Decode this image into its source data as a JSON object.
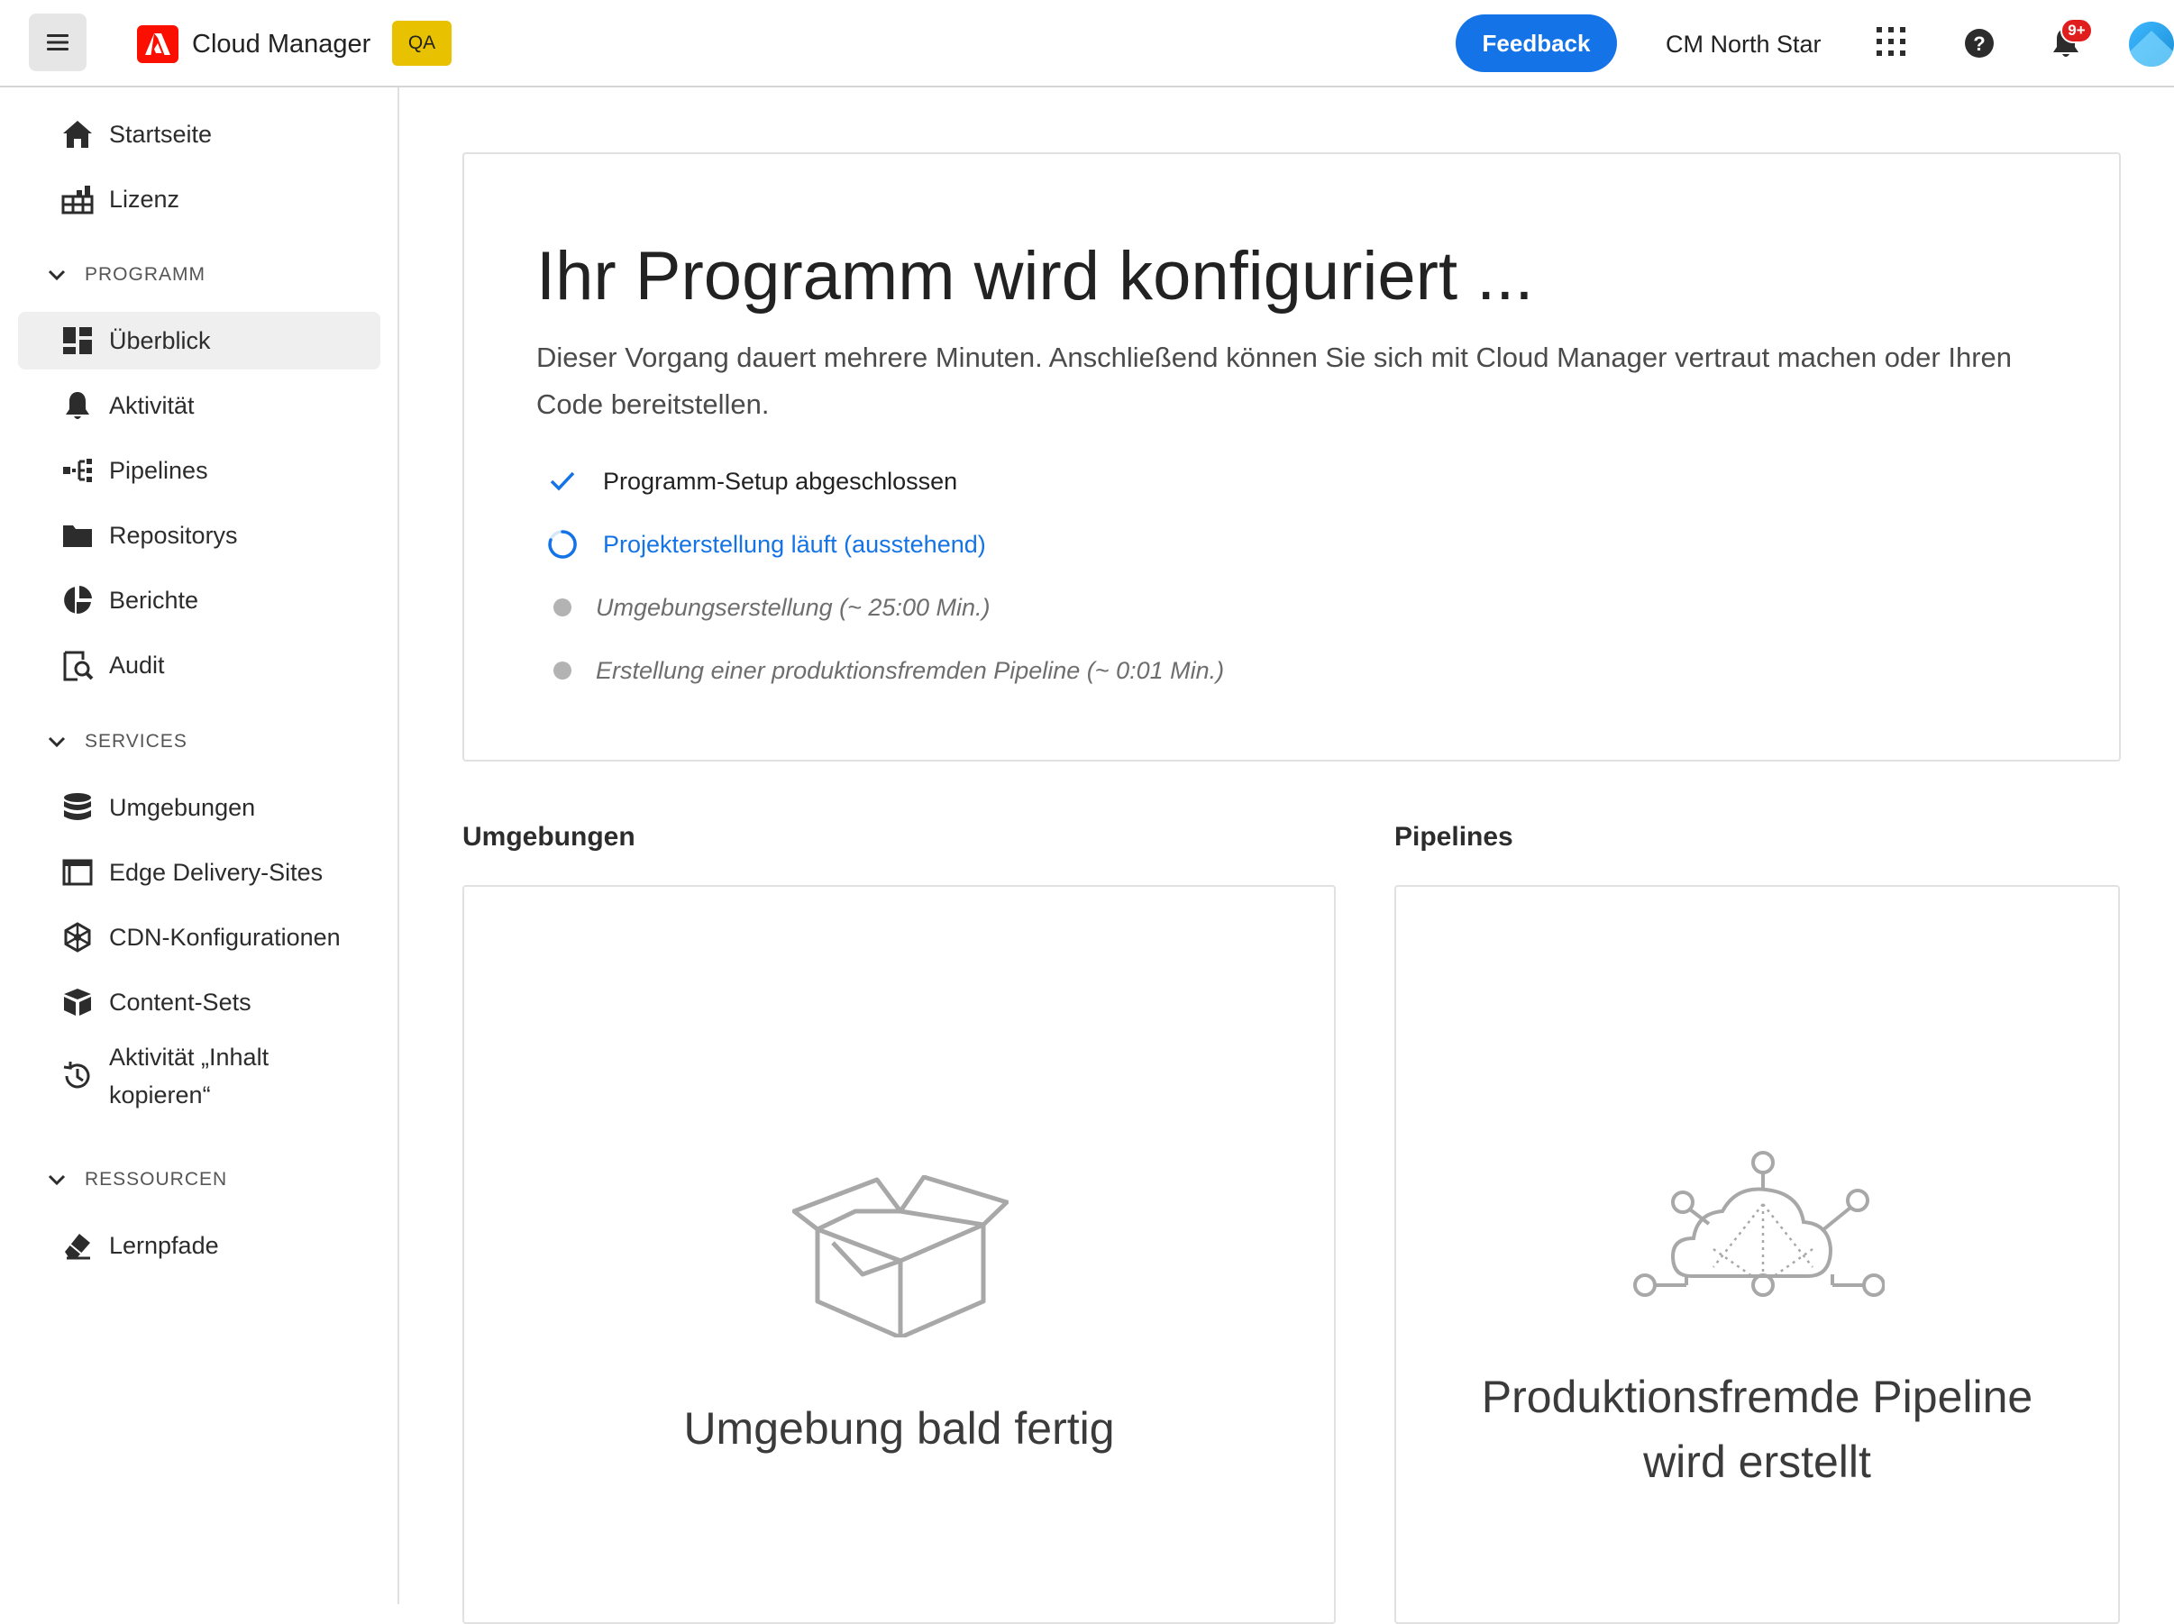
{
  "header": {
    "menu_icon": "hamburger-icon",
    "logo_icon": "adobe-logo-icon",
    "app_title": "Cloud Manager",
    "env_badge": "QA",
    "feedback_label": "Feedback",
    "org_name": "CM North Star",
    "apps_icon": "app-switcher-icon",
    "help_icon": "help-icon",
    "notifications_icon": "bell-icon",
    "notification_count": "9+",
    "accent_color": "#1473e6",
    "brand_color": "#fa0f00"
  },
  "sidebar": {
    "top_items": [
      {
        "label": "Startseite",
        "icon": "home-icon"
      },
      {
        "label": "Lizenz",
        "icon": "license-icon"
      }
    ],
    "sections": [
      {
        "title": "PROGRAMM",
        "items": [
          {
            "label": "Überblick",
            "icon": "dashboard-icon",
            "active": true
          },
          {
            "label": "Aktivität",
            "icon": "bell-icon"
          },
          {
            "label": "Pipelines",
            "icon": "pipeline-icon"
          },
          {
            "label": "Repositorys",
            "icon": "folder-icon"
          },
          {
            "label": "Berichte",
            "icon": "pie-chart-icon"
          },
          {
            "label": "Audit",
            "icon": "audit-icon"
          }
        ]
      },
      {
        "title": "SERVICES",
        "items": [
          {
            "label": "Umgebungen",
            "icon": "database-icon"
          },
          {
            "label": "Edge Delivery-Sites",
            "icon": "browser-window-icon"
          },
          {
            "label": "CDN-Konfigurationen",
            "icon": "cdn-icon"
          },
          {
            "label": "Content-Sets",
            "icon": "boxes-icon"
          },
          {
            "label_line1": "Aktivität „Inhalt",
            "label_line2": "kopieren“",
            "icon": "history-icon"
          }
        ]
      },
      {
        "title": "RESSOURCEN",
        "items": [
          {
            "label": "Lernpfade",
            "icon": "eraser-icon"
          }
        ]
      }
    ]
  },
  "main": {
    "config_card": {
      "title": "Ihr Programm wird konfiguriert ...",
      "description": "Dieser Vorgang dauert mehrere Minuten. Anschließend können Sie sich mit Cloud Manager vertraut machen oder Ihren Code bereitstellen.",
      "steps": [
        {
          "label": "Programm-Setup abgeschlossen",
          "status": "done",
          "icon": "checkmark-icon"
        },
        {
          "label": "Projekterstellung läuft (ausstehend)",
          "status": "running",
          "icon": "spinner-icon"
        },
        {
          "label": "Umgebungserstellung (~ 25:00 Min.)",
          "status": "pending",
          "icon": "pending-dot-icon"
        },
        {
          "label": "Erstellung einer produktionsfremden Pipeline (~ 0:01 Min.)",
          "status": "pending",
          "icon": "pending-dot-icon"
        }
      ]
    },
    "environments": {
      "heading": "Umgebungen",
      "illustration": "open-box-icon",
      "message": "Umgebung bald fertig"
    },
    "pipelines": {
      "heading": "Pipelines",
      "illustration": "cloud-network-icon",
      "message_line1": "Produktionsfremde Pipeline",
      "message_line2": "wird erstellt"
    }
  }
}
